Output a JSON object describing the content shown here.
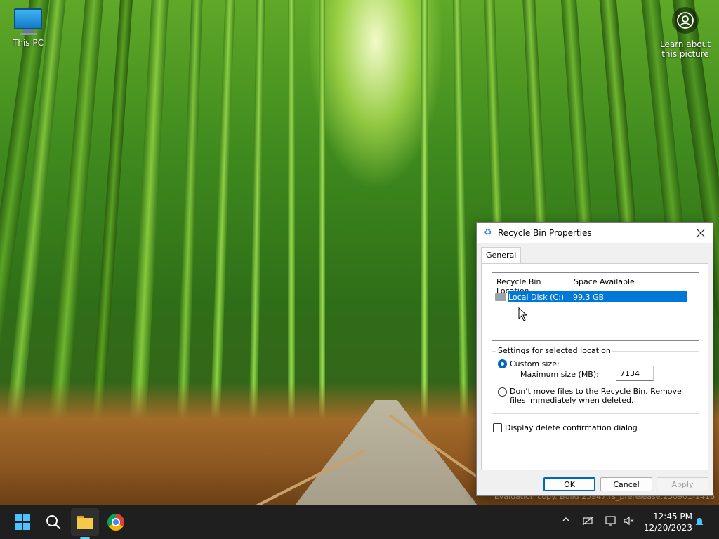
{
  "desktop": {
    "icons": [
      {
        "label": "This PC"
      },
      {
        "label": "Learn about this picture"
      }
    ],
    "watermark": "Evaluation copy. Build 25947.rs_prerelease.230901-1416"
  },
  "dialog": {
    "title": "Recycle Bin Properties",
    "tab": "General",
    "list": {
      "columns": [
        "Recycle Bin Location",
        "Space Available"
      ],
      "rows": [
        {
          "location": "Local Disk (C:)",
          "space": "99.3 GB",
          "selected": true
        }
      ]
    },
    "settings_group": "Settings for selected location",
    "custom_size_label": "Custom size:",
    "custom_size_checked": true,
    "max_size_label": "Maximum size (MB):",
    "max_size_value": "7134",
    "dont_move_label": "Don’t move files to the Recycle Bin. Remove files immediately when deleted.",
    "dont_move_checked": false,
    "confirm_label": "Display delete confirmation dialog",
    "confirm_checked": false,
    "buttons": {
      "ok": "OK",
      "cancel": "Cancel",
      "apply": "Apply"
    }
  },
  "taskbar": {
    "apps": [
      "start-icon",
      "search-icon",
      "file-explorer-icon",
      "chrome-icon"
    ],
    "active_app": "file-explorer",
    "tray": [
      "chevron-up-icon",
      "network-icon",
      "display-icon",
      "volume-muted-icon"
    ],
    "time": "12:45 PM",
    "date": "12/20/2023"
  },
  "colors": {
    "accent": "#0078d7",
    "taskbar": "#1f1f1f"
  }
}
